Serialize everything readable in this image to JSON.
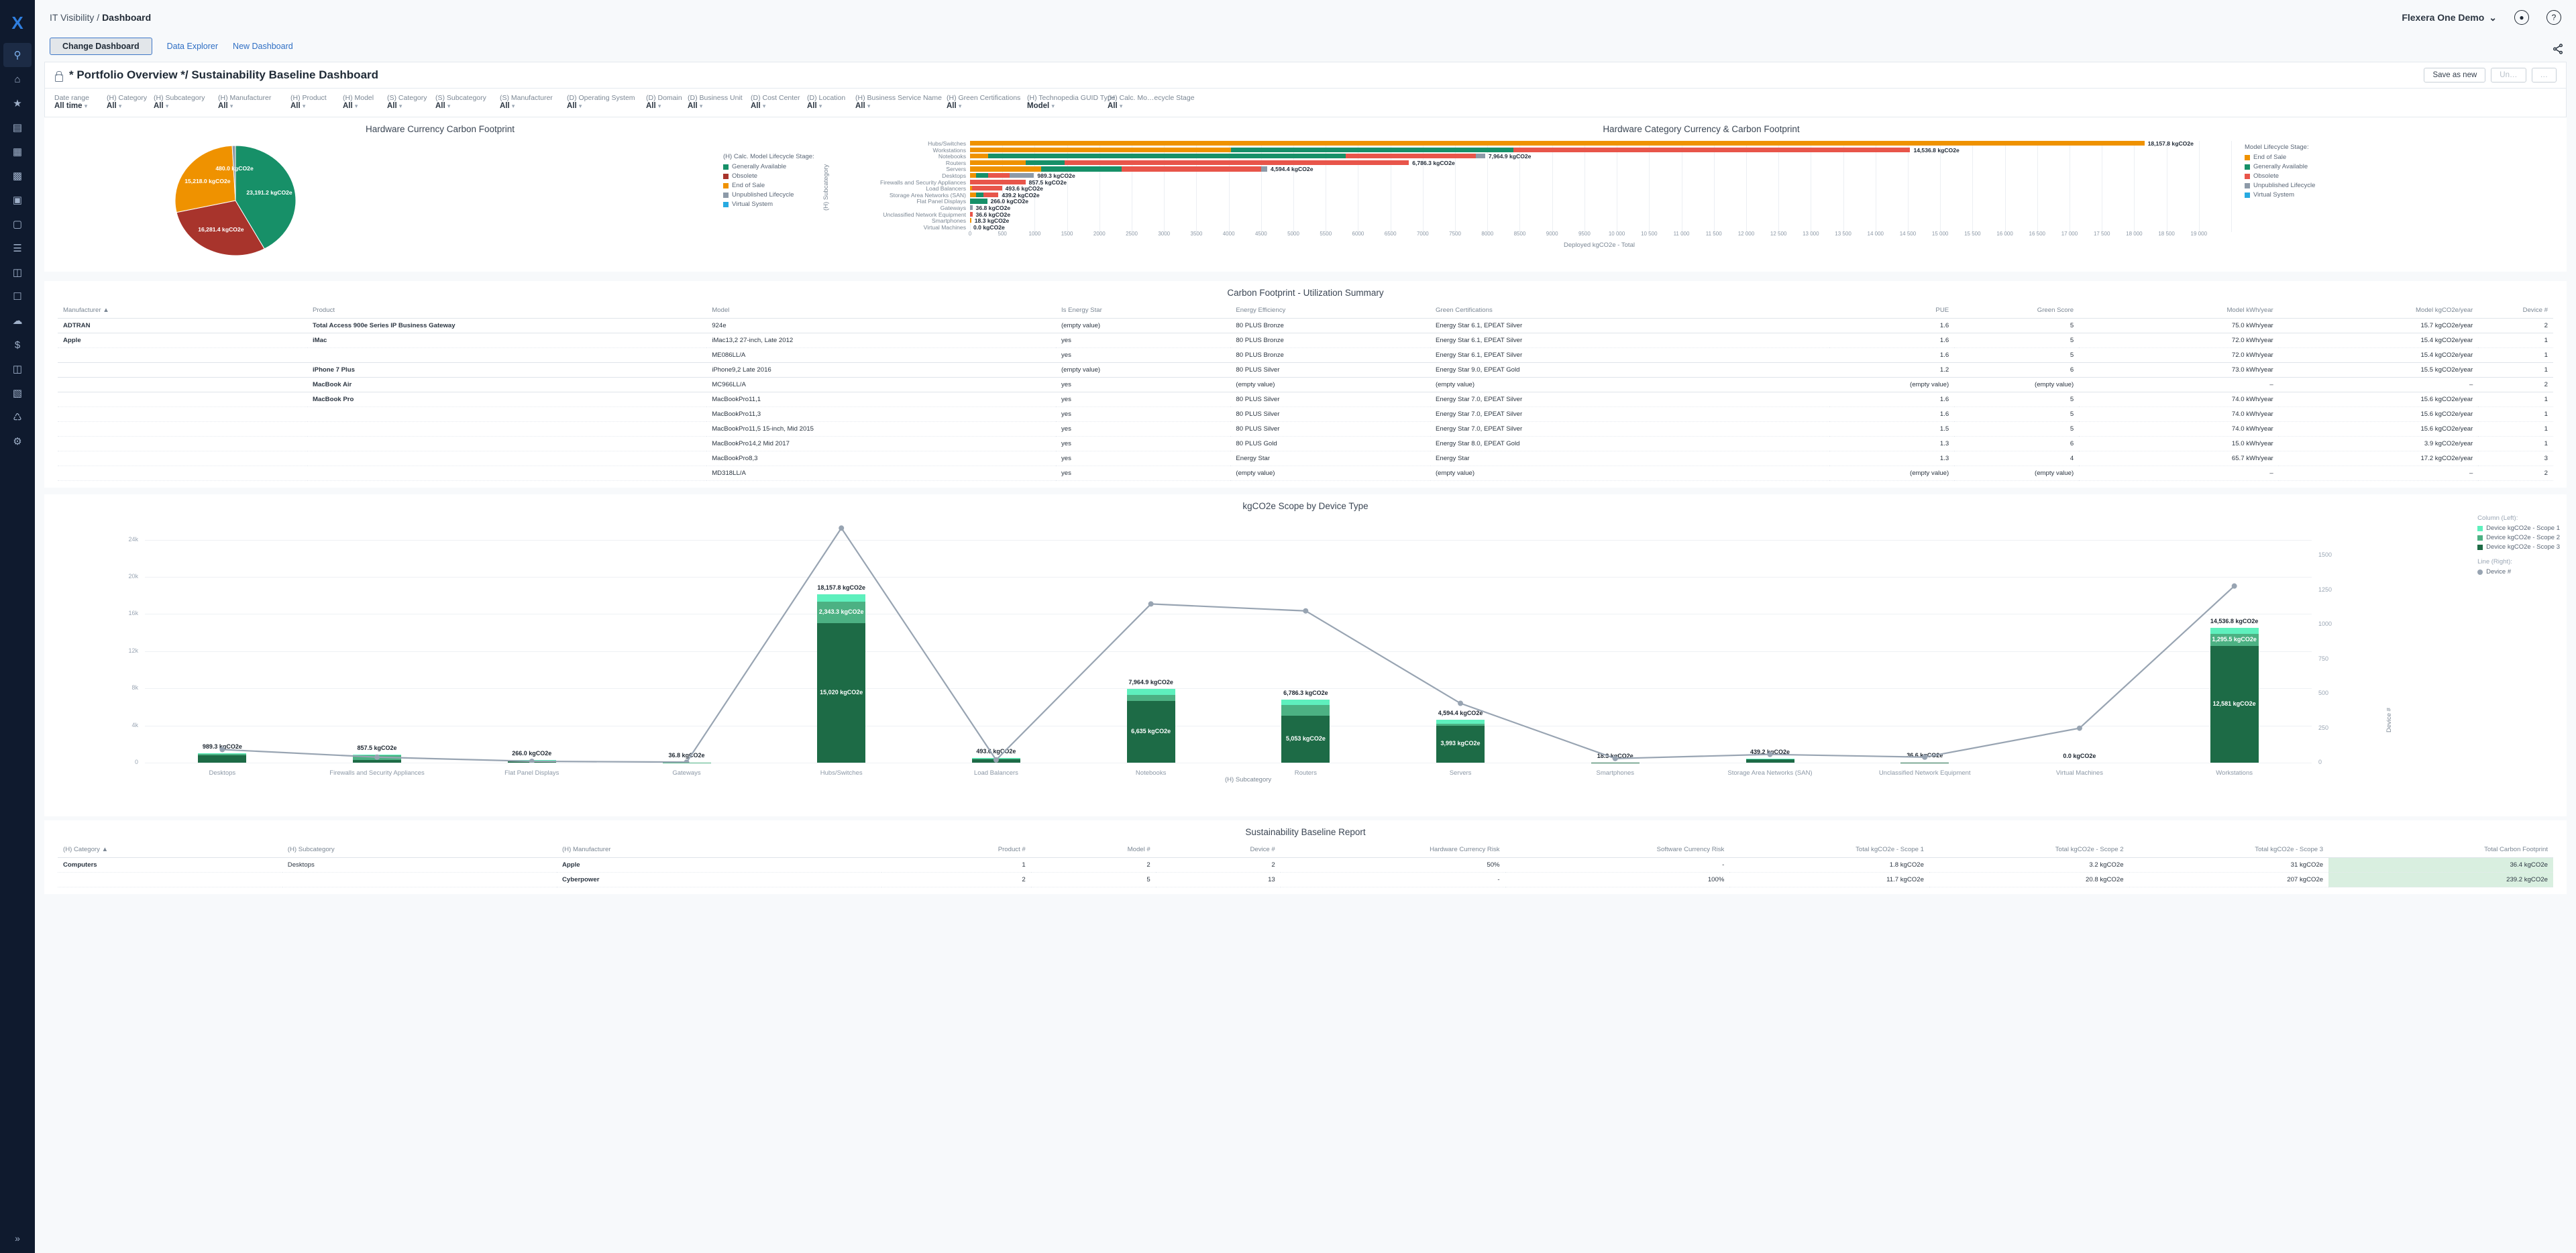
{
  "app": {
    "breadcrumb_root": "IT Visibility",
    "breadcrumb_current": "Dashboard",
    "org": "Flexera One Demo",
    "org_caret": "⌄",
    "account_icon": "user-circle-icon",
    "help_icon": "question-circle-icon",
    "share_icon": "share-icon"
  },
  "tabs": {
    "change_dashboard": "Change Dashboard",
    "data_explorer": "Data Explorer",
    "new_dashboard": "New Dashboard"
  },
  "dashboard": {
    "title": "* Portfolio Overview */ Sustainability Baseline Dashboard",
    "lock_icon": "lock-icon",
    "save_as_new": "Save as new",
    "undo": "Un…",
    "more": "…"
  },
  "filters": [
    {
      "label": "Date range",
      "value": "All time"
    },
    {
      "label": "(H) Category",
      "value": "All"
    },
    {
      "label": "(H) Subcategory",
      "value": "All"
    },
    {
      "label": "(H) Manufacturer",
      "value": "All"
    },
    {
      "label": "(H) Product",
      "value": "All"
    },
    {
      "label": "(H) Model",
      "value": "All"
    },
    {
      "label": "(S) Category",
      "value": "All"
    },
    {
      "label": "(S) Subcategory",
      "value": "All"
    },
    {
      "label": "(S) Manufacturer",
      "value": "All"
    },
    {
      "label": "(D) Operating System",
      "value": "All"
    },
    {
      "label": "(D) Domain",
      "value": "All"
    },
    {
      "label": "(D) Business Unit",
      "value": "All"
    },
    {
      "label": "(D) Cost Center",
      "value": "All"
    },
    {
      "label": "(D) Location",
      "value": "All"
    },
    {
      "label": "(H) Business Service Name",
      "value": "All"
    },
    {
      "label": "(H) Green Certifications",
      "value": "All"
    },
    {
      "label": "(H) Technopedia GUID Type",
      "value": "Model"
    },
    {
      "label": "(H) Calc. Mo…ecycle Stage",
      "value": "All"
    }
  ],
  "colors": {
    "generally_available": "#179068",
    "obsolete": "#a8342c",
    "end_of_sale": "#ef9200",
    "unpublished": "#8d9aa8",
    "virtual_system": "#27aae1",
    "bar_obsolete": "#e8554a",
    "scope1": "#5ef0bd",
    "scope2": "#4cb183",
    "scope3": "#1d6b46",
    "line": "#98a4b2",
    "highlight": "#d9efe0",
    "risk": "#d0342c"
  },
  "chart_data": [
    {
      "type": "pie",
      "title": "Hardware Currency Carbon Footprint",
      "legend_title": "(H) Calc. Model Lifecycle Stage:",
      "legend_position": "right",
      "labels": [
        "Generally Available",
        "Obsolete",
        "End of Sale",
        "Unpublished Lifecycle",
        "Virtual System"
      ],
      "values": [
        23191.2,
        16281.4,
        15218.0,
        480.0,
        0.0
      ],
      "value_labels": [
        "23,191.2 kgCO2e",
        "16,281.4 kgCO2e",
        "15,218.0 kgCO2e",
        "480.0 kgCO2e",
        "0.0 kgCO2e"
      ],
      "colors": [
        "#179068",
        "#a8342c",
        "#ef9200",
        "#8d9aa8",
        "#27aae1"
      ]
    },
    {
      "type": "bar",
      "orientation": "horizontal",
      "title": "Hardware Category Currency & Carbon Footprint",
      "ylabel": "(H) Subcategory",
      "xlabel": "Deployed kgCO2e - Total",
      "xlim": [
        0,
        19500
      ],
      "xticks": [
        "0",
        "500",
        "1000",
        "1500",
        "2000",
        "2500",
        "3000",
        "3500",
        "4000",
        "4500",
        "5000",
        "5500",
        "6000",
        "6500",
        "7000",
        "7500",
        "8000",
        "8500",
        "9000",
        "9500",
        "10 000",
        "10 500",
        "11 000",
        "11 500",
        "12 000",
        "12 500",
        "13 000",
        "13 500",
        "14 000",
        "14 500",
        "15 000",
        "15 500",
        "16 000",
        "16 500",
        "17 000",
        "17 500",
        "18 000",
        "18 500",
        "19 000"
      ],
      "legend_title": "Model Lifecycle Stage:",
      "legend": [
        "End of Sale",
        "Generally Available",
        "Obsolete",
        "Unpublished Lifecycle",
        "Virtual System"
      ],
      "legend_colors": [
        "#ef9200",
        "#179068",
        "#e8554a",
        "#8d9aa8",
        "#27aae1"
      ],
      "categories": [
        "Hubs/Switches",
        "Workstations",
        "Notebooks",
        "Routers",
        "Servers",
        "Desktops",
        "Firewalls and Security Appliances",
        "Load Balancers",
        "Storage Area Networks (SAN)",
        "Flat Panel Displays",
        "Gateways",
        "Unclassified Network Equipment",
        "Smartphones",
        "Virtual Machines"
      ],
      "totals": [
        18157.8,
        14536.8,
        7964.9,
        6786.3,
        4594.4,
        989.3,
        857.5,
        493.6,
        439.2,
        266.0,
        36.8,
        36.6,
        18.3,
        0.0
      ],
      "total_labels": [
        "18,157.8 kgCO2e",
        "14,536.8 kgCO2e",
        "7,964.9 kgCO2e",
        "6,786.3 kgCO2e",
        "4,594.4 kgCO2e",
        "989.3 kgCO2e",
        "857.5 kgCO2e",
        "493.6 kgCO2e",
        "439.2 kgCO2e",
        "266.0 kgCO2e",
        "36.8 kgCO2e",
        "36.6 kgCO2e",
        "18.3 kgCO2e",
        "0.0 kgCO2e"
      ],
      "stacks": [
        [
          18157.8,
          0,
          0,
          0,
          0
        ],
        [
          4030.0,
          4370.0,
          6136.8,
          0,
          0
        ],
        [
          280.0,
          5530.0,
          2010.0,
          145.0,
          0
        ],
        [
          860.0,
          600.0,
          5326.3,
          0,
          0
        ],
        [
          1100.0,
          1240.0,
          2160.0,
          94.4,
          0
        ],
        [
          90.0,
          190.0,
          330.0,
          379.3,
          0
        ],
        [
          0,
          0,
          857.5,
          0,
          0
        ],
        [
          30.0,
          0,
          463.6,
          0,
          0
        ],
        [
          90.0,
          120.0,
          229.2,
          0,
          0
        ],
        [
          0,
          266.0,
          0,
          0,
          0
        ],
        [
          0,
          0,
          0,
          36.8,
          0
        ],
        [
          0,
          0,
          36.6,
          0,
          0
        ],
        [
          18.3,
          0,
          0,
          0,
          0
        ],
        [
          0,
          0,
          0,
          0,
          0
        ]
      ]
    },
    {
      "type": "bar",
      "orientation": "vertical",
      "title": "kgCO2e Scope by Device Type",
      "xlabel": "(H) Subcategory",
      "ylabel_right": "Device #",
      "ylim": [
        0,
        26000
      ],
      "yticks": [
        "0",
        "4k",
        "8k",
        "12k",
        "16k",
        "20k",
        "24k"
      ],
      "ylim_right": [
        0,
        1750
      ],
      "yticks_right": [
        "0",
        "250",
        "500",
        "750",
        "1000",
        "1250",
        "1500"
      ],
      "legend_column_title": "Column (Left):",
      "legend_column": [
        "Device kgCO2e - Scope 1",
        "Device kgCO2e - Scope 2",
        "Device kgCO2e - Scope 3"
      ],
      "legend_column_colors": [
        "#5ef0bd",
        "#4cb183",
        "#1d6b46"
      ],
      "legend_line_title": "Line (Right):",
      "legend_line": [
        "Device #"
      ],
      "categories": [
        "Desktops",
        "Firewalls and Security Appliances",
        "Flat Panel Displays",
        "Gateways",
        "Hubs/Switches",
        "Load Balancers",
        "Notebooks",
        "Routers",
        "Servers",
        "Smartphones",
        "Storage Area Networks (SAN)",
        "Unclassified Network Equipment",
        "Virtual Machines",
        "Workstations"
      ],
      "totals": [
        989.3,
        857.5,
        266.0,
        36.8,
        18157.8,
        493.6,
        7964.9,
        6786.3,
        4594.4,
        18.3,
        439.2,
        36.6,
        0.0,
        14536.8
      ],
      "total_labels": [
        "989.3 kgCO2e",
        "857.5 kgCO2e",
        "266.0 kgCO2e",
        "36.8 kgCO2e",
        "18,157.8 kgCO2e",
        "493.6 kgCO2e",
        "7,964.9 kgCO2e",
        "6,786.3 kgCO2e",
        "4,594.4 kgCO2e",
        "18.3 kgCO2e",
        "439.2 kgCO2e",
        "36.6 kgCO2e",
        "0.0 kgCO2e",
        "14,536.8 kgCO2e"
      ],
      "series": [
        {
          "name": "Device kgCO2e - Scope 1",
          "values": [
            80,
            90,
            26,
            4,
            800,
            40,
            700,
            570,
            390,
            2,
            38,
            3,
            0,
            660
          ]
        },
        {
          "name": "Device kgCO2e - Scope 2",
          "values": [
            130,
            480,
            40,
            6,
            2343.3,
            60,
            630,
            1150,
            210,
            3,
            60,
            5,
            0,
            1295.5
          ]
        },
        {
          "name": "Device kgCO2e - Scope 3",
          "values": [
            779.3,
            287.5,
            200,
            26.8,
            15020,
            393.6,
            6635,
            5053,
            3993,
            13.3,
            341.2,
            28.6,
            0,
            12581
          ]
        }
      ],
      "inner_labels": [
        {
          "category": "Hubs/Switches",
          "scope2": "2,343.3 kgCO2e",
          "scope3": "15,020 kgCO2e"
        },
        {
          "category": "Notebooks",
          "scope3": "6,635 kgCO2e"
        },
        {
          "category": "Routers",
          "scope3": "5,053 kgCO2e"
        },
        {
          "category": "Servers",
          "scope3": "3,993 kgCO2e"
        },
        {
          "category": "Workstations",
          "scope2": "1,295.5 kgCO2e",
          "scope3": "12,581 kgCO2e"
        }
      ],
      "line_values": [
        95,
        40,
        10,
        4,
        1700,
        20,
        1150,
        1100,
        430,
        30,
        60,
        40,
        250,
        1280
      ]
    }
  ],
  "utilization_table": {
    "title": "Carbon Footprint - Utilization Summary",
    "columns": [
      "Manufacturer ▲",
      "Product",
      "Model",
      "Is Energy Star",
      "Energy Efficiency",
      "Green Certifications",
      "PUE",
      "Green Score",
      "Model kWh/year",
      "Model kgCO2e/year",
      "Device #"
    ],
    "rows": [
      {
        "manufacturer": "ADTRAN",
        "product": "Total Access 900e Series IP Business Gateway",
        "model": "924e",
        "energy_star": "(empty value)",
        "efficiency": "80 PLUS Bronze",
        "green": "Energy Star 6.1, EPEAT Silver",
        "pue": "1.6",
        "score": "5",
        "kwh": "75.0 kWh/year",
        "kgco2e": "15.7 kgCO2e/year",
        "devices": "2",
        "group_top": true
      },
      {
        "manufacturer": "Apple",
        "product": "iMac",
        "model": "iMac13,2 27-inch, Late 2012",
        "energy_star": "yes",
        "efficiency": "80 PLUS Bronze",
        "green": "Energy Star 6.1, EPEAT Silver",
        "pue": "1.6",
        "score": "5",
        "kwh": "72.0 kWh/year",
        "kgco2e": "15.4 kgCO2e/year",
        "devices": "1",
        "group_top": true
      },
      {
        "manufacturer": "",
        "product": "",
        "model": "ME086LL/A",
        "energy_star": "yes",
        "efficiency": "80 PLUS Bronze",
        "green": "Energy Star 6.1, EPEAT Silver",
        "pue": "1.6",
        "score": "5",
        "kwh": "72.0 kWh/year",
        "kgco2e": "15.4 kgCO2e/year",
        "devices": "1",
        "group_top": false
      },
      {
        "manufacturer": "",
        "product": "iPhone 7 Plus",
        "model": "iPhone9,2 Late 2016",
        "energy_star": "(empty value)",
        "efficiency": "80 PLUS Silver",
        "green": "Energy Star 9.0, EPEAT Gold",
        "pue": "1.2",
        "score": "6",
        "kwh": "73.0 kWh/year",
        "kgco2e": "15.5 kgCO2e/year",
        "devices": "1",
        "group_top": true
      },
      {
        "manufacturer": "",
        "product": "MacBook Air",
        "model": "MC966LL/A",
        "energy_star": "yes",
        "efficiency": "(empty value)",
        "green": "(empty value)",
        "pue": "(empty value)",
        "score": "(empty value)",
        "kwh": "–",
        "kgco2e": "–",
        "devices": "2",
        "group_top": true
      },
      {
        "manufacturer": "",
        "product": "MacBook Pro",
        "model": "MacBookPro11,1",
        "energy_star": "yes",
        "efficiency": "80 PLUS Silver",
        "green": "Energy Star 7.0, EPEAT Silver",
        "pue": "1.6",
        "score": "5",
        "kwh": "74.0 kWh/year",
        "kgco2e": "15.6 kgCO2e/year",
        "devices": "1",
        "group_top": true
      },
      {
        "manufacturer": "",
        "product": "",
        "model": "MacBookPro11,3",
        "energy_star": "yes",
        "efficiency": "80 PLUS Silver",
        "green": "Energy Star 7.0, EPEAT Silver",
        "pue": "1.6",
        "score": "5",
        "kwh": "74.0 kWh/year",
        "kgco2e": "15.6 kgCO2e/year",
        "devices": "1",
        "group_top": false
      },
      {
        "manufacturer": "",
        "product": "",
        "model": "MacBookPro11,5 15-inch, Mid 2015",
        "energy_star": "yes",
        "efficiency": "80 PLUS Silver",
        "green": "Energy Star 7.0, EPEAT Silver",
        "pue": "1.5",
        "score": "5",
        "kwh": "74.0 kWh/year",
        "kgco2e": "15.6 kgCO2e/year",
        "devices": "1",
        "group_top": false
      },
      {
        "manufacturer": "",
        "product": "",
        "model": "MacBookPro14,2 Mid 2017",
        "energy_star": "yes",
        "efficiency": "80 PLUS Gold",
        "green": "Energy Star 8.0, EPEAT Gold",
        "pue": "1.3",
        "score": "6",
        "kwh": "15.0 kWh/year",
        "kgco2e": "3.9 kgCO2e/year",
        "devices": "1",
        "group_top": false
      },
      {
        "manufacturer": "",
        "product": "",
        "model": "MacBookPro8,3",
        "energy_star": "yes",
        "efficiency": "Energy Star",
        "green": "Energy Star",
        "pue": "1.3",
        "score": "4",
        "kwh": "65.7 kWh/year",
        "kgco2e": "17.2 kgCO2e/year",
        "devices": "3",
        "group_top": false
      },
      {
        "manufacturer": "",
        "product": "",
        "model": "MD318LL/A",
        "energy_star": "yes",
        "efficiency": "(empty value)",
        "green": "(empty value)",
        "pue": "(empty value)",
        "score": "(empty value)",
        "kwh": "–",
        "kgco2e": "–",
        "devices": "2",
        "group_top": false
      }
    ]
  },
  "baseline_table": {
    "title": "Sustainability Baseline Report",
    "columns": [
      "(H) Category ▲",
      "(H) Subcategory",
      "(H) Manufacturer",
      "Product #",
      "Model #",
      "Device #",
      "Hardware Currency Risk",
      "Software Currency Risk",
      "Total kgCO2e - Scope 1",
      "Total kgCO2e - Scope 2",
      "Total kgCO2e - Scope 3",
      "Total Carbon Footprint"
    ],
    "rows": [
      {
        "category": "Computers",
        "subcategory": "Desktops",
        "manufacturer": "Apple",
        "products": "1",
        "models": "2",
        "devices": "2",
        "hw_risk": "50%",
        "sw_risk": "-",
        "scope1": "1.8 kgCO2e",
        "scope2": "3.2 kgCO2e",
        "scope3": "31 kgCO2e",
        "total": "36.4 kgCO2e"
      },
      {
        "category": "",
        "subcategory": "",
        "manufacturer": "Cyberpower",
        "products": "2",
        "models": "5",
        "devices": "13",
        "hw_risk": "-",
        "sw_risk": "100%",
        "scope1": "11.7 kgCO2e",
        "scope2": "20.8 kgCO2e",
        "scope3": "207 kgCO2e",
        "total": "239.2 kgCO2e"
      }
    ]
  }
}
